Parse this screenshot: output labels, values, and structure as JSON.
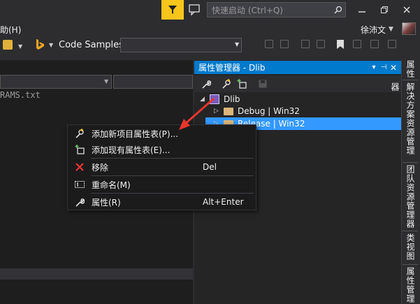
{
  "titlebar": {
    "quick_launch_placeholder": "快速启动 (Ctrl+Q)",
    "filter_color": "#f7c51b"
  },
  "menu": {
    "help_label": "助(H)"
  },
  "account": {
    "user_name": "徐沛文"
  },
  "toolbar": {
    "code_samples_label": "Code Samples"
  },
  "editor": {
    "file_fragment": "RAMS.txt"
  },
  "property_manager": {
    "title": "属性管理器 - Dlib",
    "tree": {
      "project": "Dlib",
      "configs": [
        {
          "label": "Debug | Win32",
          "selected": false
        },
        {
          "label": "Release | Win32",
          "selected": true
        }
      ]
    }
  },
  "right_tabs": [
    "属性",
    "解决方案资源管理器",
    "团队资源管理器",
    "类视图",
    "属性管理器"
  ],
  "context_menu": {
    "items": [
      {
        "label": "添加新项目属性表(P)...",
        "shortcut": "",
        "icon": "add-new-property-sheet-icon"
      },
      {
        "label": "添加现有属性表(E)...",
        "shortcut": "",
        "icon": "add-existing-property-sheet-icon"
      },
      {
        "label": "移除",
        "shortcut": "Del",
        "icon": "remove-icon"
      },
      {
        "label": "重命名(M)",
        "shortcut": "",
        "icon": "rename-icon"
      },
      {
        "label": "属性(R)",
        "shortcut": "Alt+Enter",
        "icon": "wrench-icon"
      }
    ]
  },
  "colors": {
    "accent": "#007acc",
    "selection": "#3399ff",
    "arrow": "#e8362d"
  }
}
